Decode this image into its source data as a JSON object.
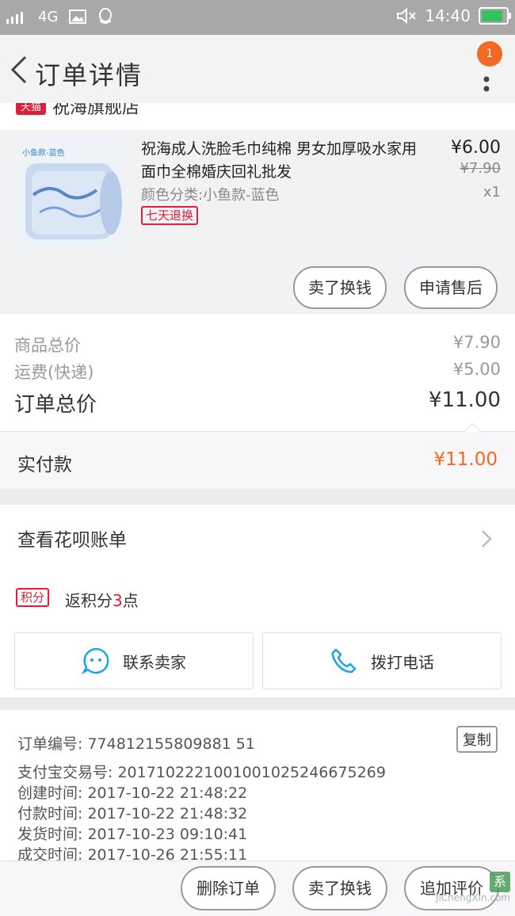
{
  "status_bar": {
    "network": "4G",
    "time": "14:40"
  },
  "header": {
    "title": "订单详情",
    "badge_count": "1"
  },
  "shop": {
    "platform_tag": "天猫",
    "name": "祝海旗舰店"
  },
  "item": {
    "thumb_label": "小鱼款-蓝色",
    "title": "祝海成人洗脸毛巾纯棉 男女加厚吸水家用面巾全棉婚庆回礼批发",
    "sku": "颜色分类:小鱼款-蓝色",
    "tag": "七天退换",
    "price_now": "¥6.00",
    "price_old": "¥7.90",
    "qty": "x1",
    "btn_refund": "卖了换钱",
    "btn_aftersale": "申请售后"
  },
  "summary": {
    "goods_label": "商品总价",
    "goods_value": "¥7.90",
    "shipping_label": "运费(快递)",
    "shipping_value": "¥5.00",
    "total_label": "订单总价",
    "total_value": "¥11.00",
    "paid_label": "实付款",
    "paid_value": "¥11.00"
  },
  "huabei": {
    "label": "查看花呗账单"
  },
  "points": {
    "tag": "积分",
    "prefix": "返积分",
    "num": "3",
    "suffix": "点"
  },
  "actions": {
    "contact_seller": "联系卖家",
    "call_phone": "拨打电话"
  },
  "order_info": {
    "order_no": "订单编号: 774812155809881 51",
    "copy_label": "复制",
    "alipay_no": "支付宝交易号: 2017102221001001025246675269",
    "created": "创建时间: 2017-10-22 21:48:22",
    "paid": "付款时间: 2017-10-22 21:48:32",
    "shipped": "发货时间: 2017-10-23 09:10:41",
    "closed": "成交时间: 2017-10-26 21:55:11"
  },
  "bottom": {
    "delete_order": "删除订单",
    "sell": "卖了换钱",
    "review": "追加评价"
  },
  "watermark": {
    "text": "JiChengXin.com"
  },
  "colors": {
    "accent_orange": "#f26922",
    "tmall_red": "#d9213b",
    "status_bar": "#a8a8a8"
  }
}
